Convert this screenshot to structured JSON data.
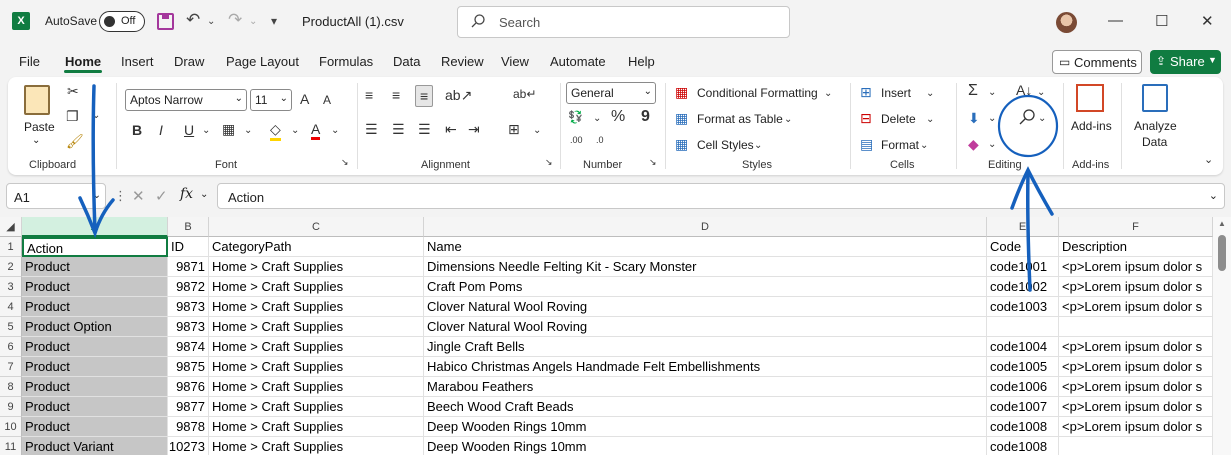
{
  "titlebar": {
    "logo": "X",
    "autosave_label": "AutoSave",
    "autosave_state": "Off",
    "filename": "ProductAll (1).csv",
    "search_placeholder": "Search",
    "minimize": "—",
    "maximize": "☐",
    "close": "✕"
  },
  "menu": {
    "tabs": [
      "File",
      "Home",
      "Insert",
      "Draw",
      "Page Layout",
      "Formulas",
      "Data",
      "Review",
      "View",
      "Automate",
      "Help"
    ],
    "active_tab": "Home",
    "comments_label": "Comments",
    "share_label": "Share"
  },
  "ribbon": {
    "clipboard": {
      "paste_label": "Paste",
      "group_label": "Clipboard"
    },
    "font": {
      "font_name": "Aptos Narrow",
      "font_size": "11",
      "group_label": "Font",
      "bold": "B",
      "italic": "I",
      "underline": "U"
    },
    "alignment": {
      "group_label": "Alignment"
    },
    "number": {
      "format": "General",
      "group_label": "Number",
      "percent": "%",
      "comma": "9"
    },
    "styles": {
      "conditional_formatting": "Conditional Formatting",
      "format_as_table": "Format as Table",
      "cell_styles": "Cell Styles",
      "group_label": "Styles"
    },
    "cells": {
      "insert": "Insert",
      "delete": "Delete",
      "format": "Format",
      "group_label": "Cells"
    },
    "editing": {
      "group_label": "Editing"
    },
    "addins": {
      "label": "Add-ins",
      "group_label": "Add-ins"
    },
    "analyze": {
      "label_line1": "Analyze",
      "label_line2": "Data"
    }
  },
  "formula_bar": {
    "name_box": "A1",
    "fx": "fx",
    "content": "Action"
  },
  "sheet": {
    "columns": [
      "A",
      "B",
      "C",
      "D",
      "E",
      "F"
    ],
    "selected_column": "A",
    "rows": [
      {
        "n": "1",
        "a": "Action",
        "b": "ID",
        "c": "CategoryPath",
        "d": "Name",
        "e": "Code",
        "f": "Description"
      },
      {
        "n": "2",
        "a": "Product",
        "b": "9871",
        "c": "Home > Craft Supplies",
        "d": "Dimensions Needle Felting Kit - Scary Monster",
        "e": "code1001",
        "f": "<p>Lorem ipsum dolor s"
      },
      {
        "n": "3",
        "a": "Product",
        "b": "9872",
        "c": "Home > Craft Supplies",
        "d": "Craft Pom Poms",
        "e": "code1002",
        "f": "<p>Lorem ipsum dolor s"
      },
      {
        "n": "4",
        "a": "Product",
        "b": "9873",
        "c": "Home > Craft Supplies",
        "d": "Clover Natural Wool Roving",
        "e": "code1003",
        "f": "<p>Lorem ipsum dolor s"
      },
      {
        "n": "5",
        "a": "Product Option",
        "b": "9873",
        "c": "Home > Craft Supplies",
        "d": "Clover Natural Wool Roving",
        "e": "",
        "f": ""
      },
      {
        "n": "6",
        "a": "Product",
        "b": "9874",
        "c": "Home > Craft Supplies",
        "d": "Jingle Craft Bells",
        "e": "code1004",
        "f": "<p>Lorem ipsum dolor s"
      },
      {
        "n": "7",
        "a": "Product",
        "b": "9875",
        "c": "Home > Craft Supplies",
        "d": "Habico Christmas Angels Handmade Felt Embellishments",
        "e": "code1005",
        "f": "<p>Lorem ipsum dolor s"
      },
      {
        "n": "8",
        "a": "Product",
        "b": "9876",
        "c": "Home > Craft Supplies",
        "d": "Marabou Feathers",
        "e": "code1006",
        "f": "<p>Lorem ipsum dolor s"
      },
      {
        "n": "9",
        "a": "Product",
        "b": "9877",
        "c": "Home > Craft Supplies",
        "d": "Beech Wood Craft Beads",
        "e": "code1007",
        "f": "<p>Lorem ipsum dolor s"
      },
      {
        "n": "10",
        "a": "Product",
        "b": "9878",
        "c": "Home > Craft Supplies",
        "d": "Deep Wooden Rings 10mm",
        "e": "code1008",
        "f": "<p>Lorem ipsum dolor s"
      },
      {
        "n": "11",
        "a": "Product Variant",
        "b": "10273",
        "c": "Home > Craft Supplies",
        "d": "Deep Wooden Rings 10mm",
        "e": "code1008",
        "f": ""
      }
    ]
  },
  "colors": {
    "accent": "#107c41",
    "annotation": "#1560bd",
    "selected_col": "#c6c6c6"
  }
}
